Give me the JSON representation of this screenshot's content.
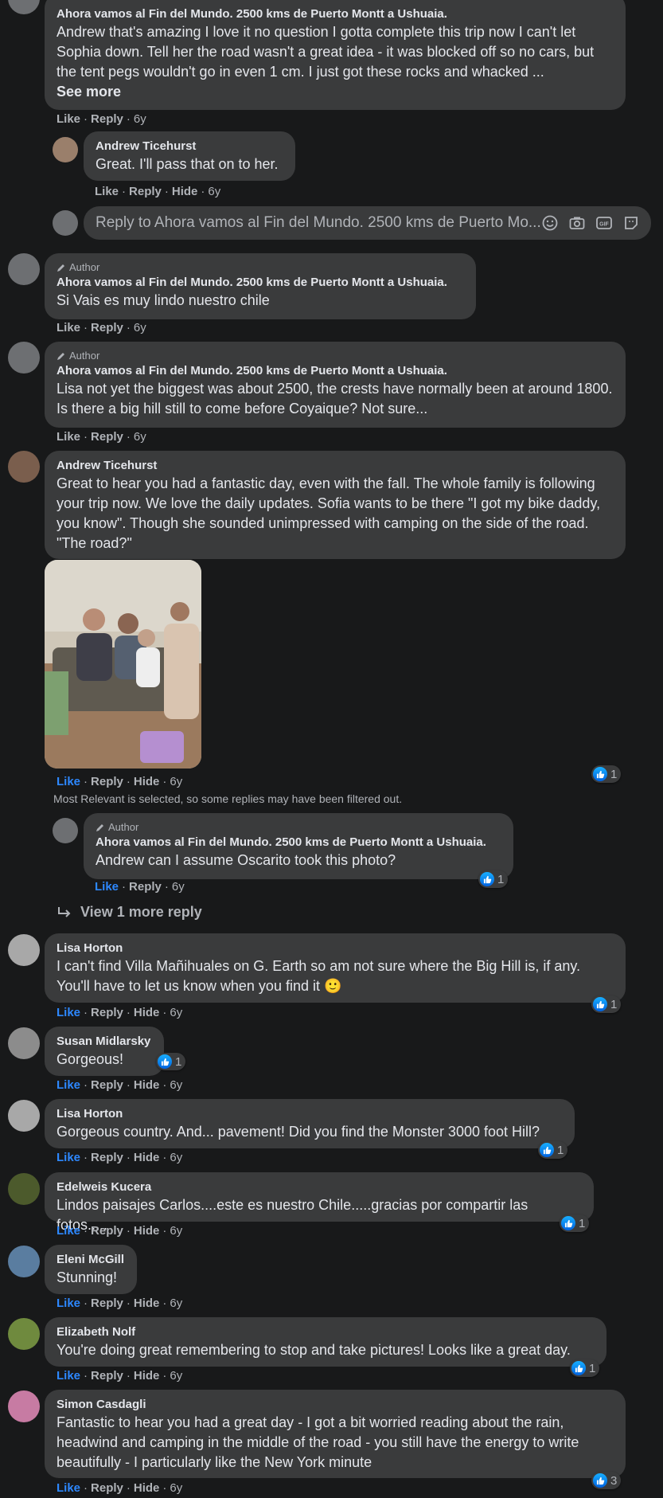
{
  "colors": {
    "background": "#18191a",
    "bubble": "#3a3b3c",
    "link": "#2d88ff",
    "muted": "#b0b3b8",
    "text": "#e4e6eb"
  },
  "common": {
    "like": "Like",
    "reply": "Reply",
    "hide": "Hide",
    "age": "6y",
    "author": "Author",
    "page_name": "Ahora vamos al Fin del Mundo. 2500 kms de Puerto Montt a Ushuaia."
  },
  "c1": {
    "text": "Andrew that's amazing I love it no question I gotta complete this trip now I can't let Sophia down. Tell her the road wasn't a great idea - it was blocked off so no cars, but the tent pegs wouldn't go in even 1 cm. I just got these rocks and whacked ...",
    "see_more": "See more"
  },
  "c1r1": {
    "name": "Andrew Ticehurst",
    "text": "Great. I'll pass that on to her."
  },
  "reply_box": {
    "placeholder": "Reply to Ahora vamos al Fin del Mundo. 2500 kms de Puerto Mo..."
  },
  "c2": {
    "text": "Si Vais es muy lindo nuestro chile"
  },
  "c3": {
    "text": "Lisa not yet the biggest was about 2500, the crests have normally been at around 1800. Is there a big hill still to come before Coyaique? Not sure..."
  },
  "c4": {
    "name": "Andrew Ticehurst",
    "text": "Great to hear you had a fantastic day, even with the fall. The whole family is following your trip now. We love the daily updates. Sofia wants to be there \"I got my bike daddy, you know\". Though she sounded unimpressed with camping on the side of the road. \"The road?\"",
    "reactions": "1",
    "filter_note": "Most Relevant is selected, so some replies may have been filtered out."
  },
  "c4r1": {
    "text": "Andrew can I assume Oscarito took this photo?",
    "reactions": "1"
  },
  "view_more": "View 1 more reply",
  "c5": {
    "name": "Lisa Horton",
    "text": "I can't find Villa Mañihuales on G. Earth so am not sure where the Big Hill is, if any. You'll have to let us know when you find it 🙂",
    "reactions": "1"
  },
  "c6": {
    "name": "Susan Midlarsky",
    "text": "Gorgeous!",
    "reactions": "1"
  },
  "c7": {
    "name": "Lisa Horton",
    "text": "Gorgeous country. And... pavement! Did you find the Monster 3000 foot Hill?",
    "reactions": "1"
  },
  "c8": {
    "name": "Edelweis Kucera",
    "text": "Lindos paisajes Carlos....este es nuestro Chile.....gracias por compartir las fotos.....",
    "reactions": "1"
  },
  "c9": {
    "name": "Eleni McGill",
    "text": "Stunning!"
  },
  "c10": {
    "name": "Elizabeth Nolf",
    "text": "You're doing great remembering to stop and take pictures! Looks like a great day.",
    "reactions": "1"
  },
  "c11": {
    "name": "Simon Casdagli",
    "text": "Fantastic to hear you had a great day - I got a bit worried reading about the rain, headwind and camping in the middle of the road - you still have the energy to write beautifully - I particularly like the New York minute",
    "reactions": "3"
  }
}
